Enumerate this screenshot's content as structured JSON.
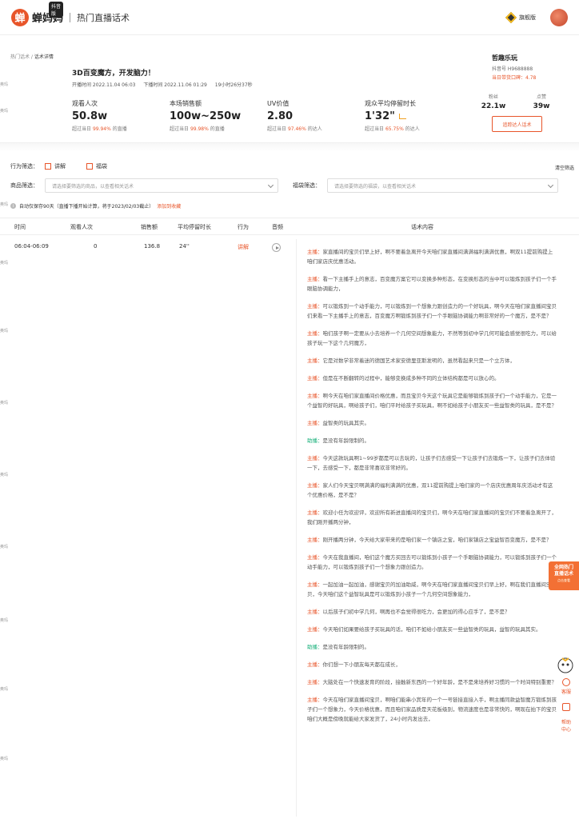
{
  "header": {
    "logo_text": "蝉妈妈",
    "logo_tag": "抖音版",
    "page_title": "热门直播话术",
    "vip_label": "旗舰版"
  },
  "side_label": "奥玛",
  "breadcrumb": {
    "parent": "热门话术 / ",
    "current": "话术详情"
  },
  "live": {
    "title": "3D百变魔方，开发脑力！",
    "start": "开播时间  2022.11.04 06:03",
    "end": "下播时间  2022.11.06 01:29",
    "duration": "19小时26分37秒"
  },
  "stats": [
    {
      "label": "观看人次",
      "value": "50.8w",
      "sub_prefix": "超过当日",
      "sub_pct": "99.94%",
      "sub_suffix": "的直播"
    },
    {
      "label": "本场销售额",
      "value": "100w~250w",
      "sub_prefix": "超过当日",
      "sub_pct": "99.98%",
      "sub_suffix": "的直播"
    },
    {
      "label": "UV价值",
      "value": "2.80",
      "sub_prefix": "超过当日",
      "sub_pct": "97.46%",
      "sub_suffix": "的达人"
    },
    {
      "label": "观众平均停留时长",
      "value": "1'32\"",
      "sub_prefix": "超过当日",
      "sub_pct": "65.75%",
      "sub_suffix": "的达人"
    }
  ],
  "shop": {
    "name": "哲趣乐玩",
    "douyin_id": "抖音号 H9688888",
    "score": "当日带货口碑：4.78",
    "fans_label": "粉丝",
    "fans_value": "22.1w",
    "likes_label": "点赞",
    "likes_value": "39w",
    "follow_btn": "追踪达人话术"
  },
  "filters": {
    "behavior_label": "行为筛选：",
    "opt1": "讲解",
    "opt2": "福袋",
    "clear": "清空筛选",
    "product_label": "商品筛选：",
    "product_placeholder": "请选择要筛选的商品，以查看相关话术",
    "bag_label": "福袋筛选：",
    "bag_placeholder": "请选择要筛选的福袋，以查看相关话术",
    "note": "自动仅保存90天（直播下播开始计算，将于2023/02/03截止）",
    "note_link": "添加到收藏"
  },
  "table": {
    "headers": [
      "时间",
      "观看人次",
      "销售额",
      "平均停留时长",
      "行为",
      "音频",
      "话术内容"
    ],
    "row": {
      "time": "06:04-06:09",
      "views": "0",
      "sales": "136.8",
      "stay": "24''",
      "action": "讲解"
    }
  },
  "script": [
    {
      "speaker": "主播",
      "type": "host",
      "text": "家直播间的宝贝们早上好，啊不要着急离开今天咱们家直播间满满福利满满优惠，啊双11提前购提上咱们家店庆优惠活动。"
    },
    {
      "speaker": "主播",
      "type": "host",
      "text": "看一下主播手上的意志，百变魔方案它可以变换多种形态，在变换形态的当中可以锻炼到孩子们一个手眼脑协调能力，"
    },
    {
      "speaker": "主播",
      "type": "host",
      "text": "可以锻炼到一个动手能力，可以锻炼到一个想象力跟创造力的一个好玩具，啊今天在咱们家直播间宝贝们来看一下主播手上的意志，百变魔方啊锻炼到孩子们一个手眼脑协调能力啊非常好的一个魔方，是不是？"
    },
    {
      "speaker": "主播",
      "type": "host",
      "text": "咱们孩子啊一定要从小去培养一个几何空间想象能力，不然等到初中学几何可能会感觉很吃力，可以给孩子玩一下这个几何魔方，"
    },
    {
      "speaker": "主播",
      "type": "host",
      "text": "它是对数学非常着迷的德国艺术家安德里亚斯发明的，虽然看起来只是一个立方体，"
    },
    {
      "speaker": "主播",
      "type": "host",
      "text": "但是在不断翻转的过程中，能够变换成多种不同的立体结构都是可以放心的。"
    },
    {
      "speaker": "主播",
      "type": "host",
      "text": "啊今天在咱们家直播间价格优惠，而且宝贝今天这个玩具它是能够锻炼到孩子们一个动手能力，它是一个益智的好玩具，啊给孩子们，咱们平时给孩子买玩具，啊不如给孩子小朋友买一些益智类的玩具，是不是？"
    },
    {
      "speaker": "主播",
      "type": "host",
      "text": "益智类的玩具其实。"
    },
    {
      "speaker": "助播",
      "type": "help",
      "text": "是没有年龄限制的。"
    },
    {
      "speaker": "主播",
      "type": "host",
      "text": "今天这款玩具啊1~99岁都是可以去玩的，让孩子们去感受一下让孩子们去锻炼一下，让孩子们去体验一下，去感受一下，都是非常喜欢非常好的。"
    },
    {
      "speaker": "主播",
      "type": "host",
      "text": "家人们今天宝贝啊满满的福利满满的优惠，双11提前购提上咱们家的一个店庆优惠周年庆活动才有这个优惠价格，是不是？"
    },
    {
      "speaker": "主播",
      "type": "host",
      "text": "欢迎小任为欢迎评，欢迎所有新进直播间的宝贝们，啊今天在咱们家直播间的宝贝们不要着急离开了，我们刚开播两分钟，"
    },
    {
      "speaker": "主播",
      "type": "host",
      "text": "刚开播两分钟，今天给大家带来的是咱们家一个镇店之宝，咱们家镇店之宝益智百变魔方，是不是？"
    },
    {
      "speaker": "主播",
      "type": "host",
      "text": "今天在我直播间，咱们这个魔方买回去可以锻炼到小孩子一个手眼脑协调能力，可以锻炼到孩子们一个动手能力，可以锻炼到孩子们一个想象力跟创造力。"
    },
    {
      "speaker": "主播",
      "type": "host",
      "text": "一起加油一起加油，感谢宝贝的加油助威，啊今天在咱们家直播间宝贝们早上好，啊在我们直播间宝贝，今天咱们这个益智玩具是可以锻炼到小孩子一个几何空间想象能力，"
    },
    {
      "speaker": "主播",
      "type": "host",
      "text": "以后孩子们初中学几何，啊再也不会觉得很吃力，会更加的得心应手了，是不是？"
    },
    {
      "speaker": "主播",
      "type": "host",
      "text": "今天咱们如果要给孩子买玩具的话，咱们不如给小朋友买一些益智类的玩具，益智的玩具其实。"
    },
    {
      "speaker": "助播",
      "type": "help",
      "text": "是没有年龄限制的。"
    },
    {
      "speaker": "主播",
      "type": "host",
      "text": "你们想一下小朋友每天都在成长，"
    },
    {
      "speaker": "主播",
      "type": "host",
      "text": "大脑处在一个快速发育的阶段，接触新东西的一个好年龄，是不是来培养好习惯的一个时间特别重要？"
    },
    {
      "speaker": "主播",
      "type": "host",
      "text": "今天在咱们家直播间宝贝，啊咱们能串小宾年的一个一号链接直接入手，啊主播同款益智魔方锻炼到孩子们一个想象力，今天价格优惠，而且咱们家品质是天花板级别，物流速度也是非常快的，啊现在拍下的宝贝咱们大概是傍晚就能给大家发货了，24小时内发出去，"
    }
  ],
  "promo": {
    "line1": "全网热门",
    "line2": "直播话术",
    "small": "点击查看"
  },
  "tools": {
    "service": "客服",
    "help": "帮助中心"
  }
}
